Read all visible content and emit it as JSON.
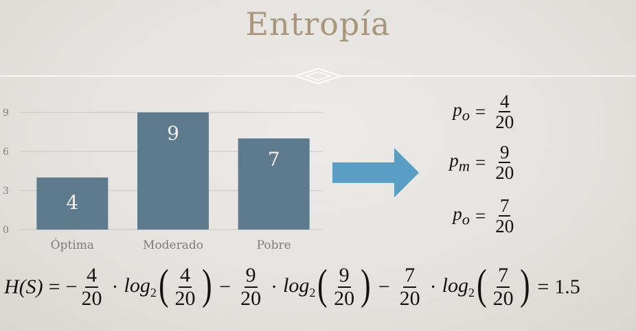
{
  "title": "Entropía",
  "chart_data": {
    "type": "bar",
    "categories": [
      "Óptima",
      "Moderado",
      "Pobre"
    ],
    "values": [
      4,
      9,
      7
    ],
    "yticks": [
      "0",
      "3",
      "6",
      "9"
    ],
    "ylim": [
      0,
      10
    ],
    "grid": true,
    "bar_color": "#5e7a8d"
  },
  "arrow_color": "#5a9ec6",
  "probabilities": [
    {
      "lhs": "p",
      "sub": "o",
      "num": "4",
      "den": "20"
    },
    {
      "lhs": "p",
      "sub": "m",
      "num": "9",
      "den": "20"
    },
    {
      "lhs": "p",
      "sub": "o",
      "num": "7",
      "den": "20"
    }
  ],
  "formula": {
    "lhs": "H(S)",
    "terms": [
      {
        "num": "4",
        "den": "20"
      },
      {
        "num": "9",
        "den": "20"
      },
      {
        "num": "7",
        "den": "20"
      }
    ],
    "log": "log",
    "log_base": "2",
    "result": "1.5"
  }
}
